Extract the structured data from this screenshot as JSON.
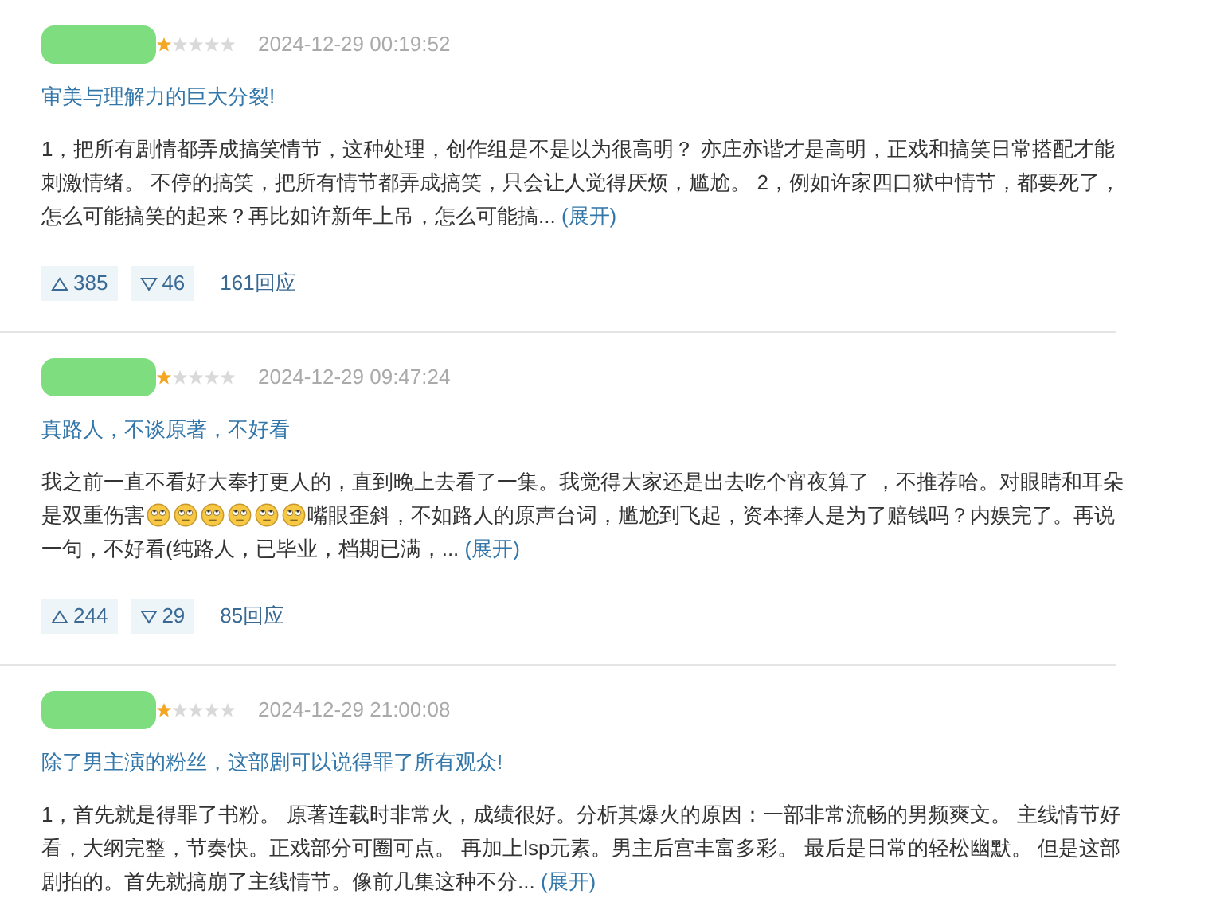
{
  "reviews": [
    {
      "stars": 1,
      "time": "2024-12-29 00:19:52",
      "title": "审美与理解力的巨大分裂!",
      "body": [
        {
          "kind": "text",
          "text": "1，把所有剧情都弄成搞笑情节，这种处理，创作组是不是以为很高明？ 亦庄亦谐才是高明，正戏和搞笑日常搭配才能刺激情绪。 不停的搞笑，把所有情节都弄成搞笑，只会让人觉得厌烦，尴尬。 2，例如许家四口狱中情节，都要死了，怎么可能搞笑的起来？再比如许新年上吊，怎么可能搞..."
        }
      ],
      "expand": "(展开)",
      "up": "385",
      "down": "46",
      "replies": "161回应"
    },
    {
      "stars": 1,
      "time": "2024-12-29 09:47:24",
      "title": "真路人，不谈原著，不好看",
      "body": [
        {
          "kind": "text",
          "text": "我之前一直不看好大奉打更人的，直到晚上去看了一集。我觉得大家还是出去吃个宵夜算了 ，不推荐哈。对眼睛和耳朵是双重伤害"
        },
        {
          "kind": "emoji"
        },
        {
          "kind": "emoji"
        },
        {
          "kind": "emoji"
        },
        {
          "kind": "emoji"
        },
        {
          "kind": "emoji"
        },
        {
          "kind": "emoji"
        },
        {
          "kind": "text",
          "text": "嘴眼歪斜，不如路人的原声台词，尴尬到飞起，资本捧人是为了赔钱吗？内娱完了。再说一句，不好看(纯路人，已毕业，档期已满，..."
        }
      ],
      "expand": "(展开)",
      "up": "244",
      "down": "29",
      "replies": "85回应"
    },
    {
      "stars": 1,
      "time": "2024-12-29 21:00:08",
      "title": "除了男主演的粉丝，这部剧可以说得罪了所有观众!",
      "body": [
        {
          "kind": "text",
          "text": "1，首先就是得罪了书粉。 原著连载时非常火，成绩很好。分析其爆火的原因：一部非常流畅的男频爽文。 主线情节好看，大纲完整，节奏快。正戏部分可圈可点。 再加上lsp元素。男主后宫丰富多彩。 最后是日常的轻松幽默。 但是这部剧拍的。首先就搞崩了主线情节。像前几集这种不分..."
        }
      ],
      "expand": "(展开)"
    }
  ]
}
